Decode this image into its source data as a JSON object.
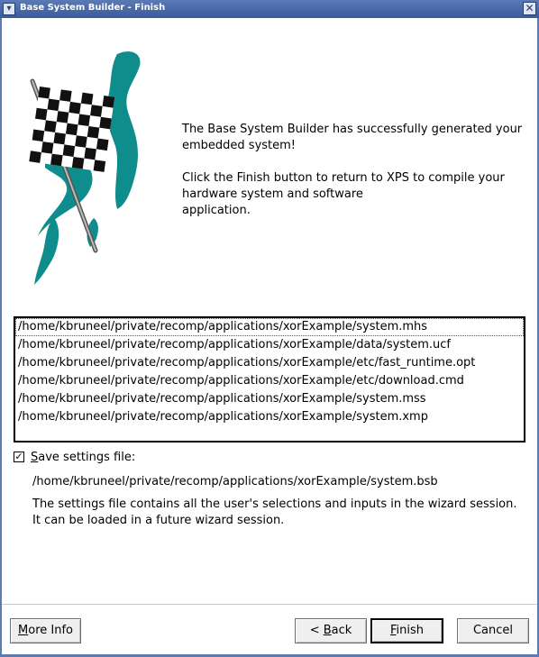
{
  "window": {
    "title": "Base System Builder - Finish",
    "menu_icon": "chevron-down-icon",
    "close_icon": "close-icon"
  },
  "message": {
    "line1": "The Base System Builder has successfully generated your\nembedded system!",
    "line2": "Click the Finish button to return to XPS to compile your\nhardware system and software\napplication."
  },
  "files": [
    "/home/kbruneel/private/recomp/applications/xorExample/system.mhs",
    "/home/kbruneel/private/recomp/applications/xorExample/data/system.ucf",
    "/home/kbruneel/private/recomp/applications/xorExample/etc/fast_runtime.opt",
    "/home/kbruneel/private/recomp/applications/xorExample/etc/download.cmd",
    "/home/kbruneel/private/recomp/applications/xorExample/system.mss",
    "/home/kbruneel/private/recomp/applications/xorExample/system.xmp"
  ],
  "save_settings": {
    "checked": true,
    "label_mnemonic": "S",
    "label_rest": "ave settings file:",
    "path": "/home/kbruneel/private/recomp/applications/xorExample/system.bsb",
    "description": "The settings file contains all the user's selections and inputs in the wizard session.\nIt can be loaded in a future wizard session."
  },
  "buttons": {
    "more_info": {
      "mnemonic": "M",
      "rest": "ore Info"
    },
    "back": {
      "prefix": "< ",
      "mnemonic": "B",
      "rest": "ack"
    },
    "finish": {
      "mnemonic": "F",
      "rest": "inish"
    },
    "cancel": {
      "label": "Cancel"
    }
  },
  "colors": {
    "titlebar": "#3a5a9a",
    "flag_teal": "#0f8c8c"
  }
}
